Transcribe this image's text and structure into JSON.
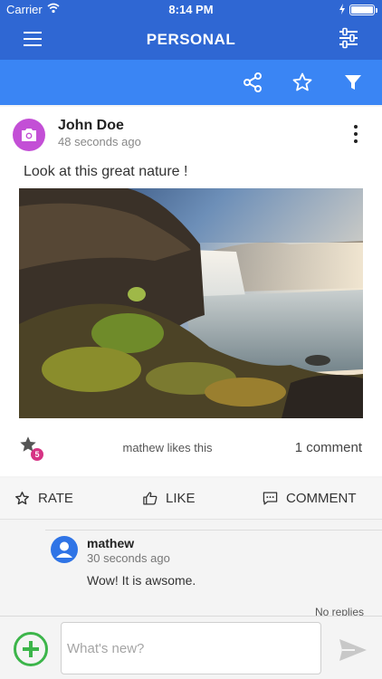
{
  "status_bar": {
    "carrier": "Carrier",
    "time": "8:14 PM",
    "battery_level": 1.0
  },
  "nav": {
    "title": "PERSONAL"
  },
  "toolbar_icons": [
    "share-icon",
    "star-icon",
    "filter-icon"
  ],
  "post": {
    "author": "John Doe",
    "time_ago": "48 seconds ago",
    "text": "Look at this great nature !",
    "rating_count": "5",
    "likes_text": "mathew likes this",
    "comment_count": "1 comment"
  },
  "actions": {
    "rate": "RATE",
    "like": "LIKE",
    "comment": "COMMENT"
  },
  "comment": {
    "author": "mathew",
    "time_ago": "30 seconds ago",
    "text": "Wow! It is awsome.",
    "replies": "No replies"
  },
  "composer": {
    "placeholder": "What's new?"
  },
  "colors": {
    "nav": "#2f67d3",
    "subbar": "#3a85f4",
    "avatar": "#c34fd6",
    "badge": "#d63384",
    "add": "#3cb54a"
  }
}
